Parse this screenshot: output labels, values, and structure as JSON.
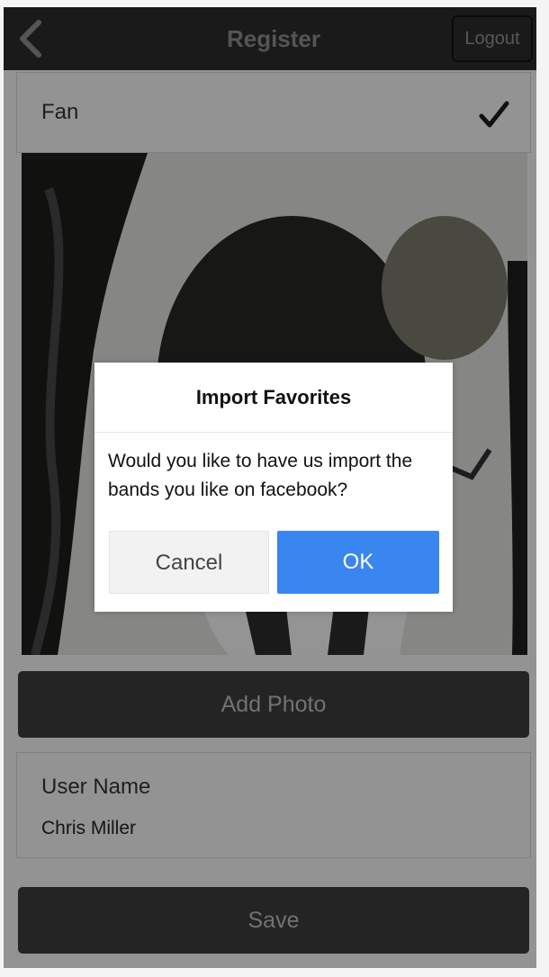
{
  "header": {
    "title": "Register",
    "back_icon": "chevron-left-icon",
    "logout_label": "Logout"
  },
  "role": {
    "label": "Fan",
    "selected_icon": "checkmark-icon"
  },
  "buttons": {
    "add_photo_label": "Add Photo",
    "save_label": "Save"
  },
  "user_name": {
    "label": "User Name",
    "value": "Chris Miller"
  },
  "dialog": {
    "title": "Import Favorites",
    "message": "Would you like to have us import the bands you like on facebook?",
    "cancel_label": "Cancel",
    "ok_label": "OK"
  },
  "colors": {
    "header_bg": "#2a2a2a",
    "ok_button": "#3a86f0",
    "dark_button": "#3a3a3a"
  }
}
